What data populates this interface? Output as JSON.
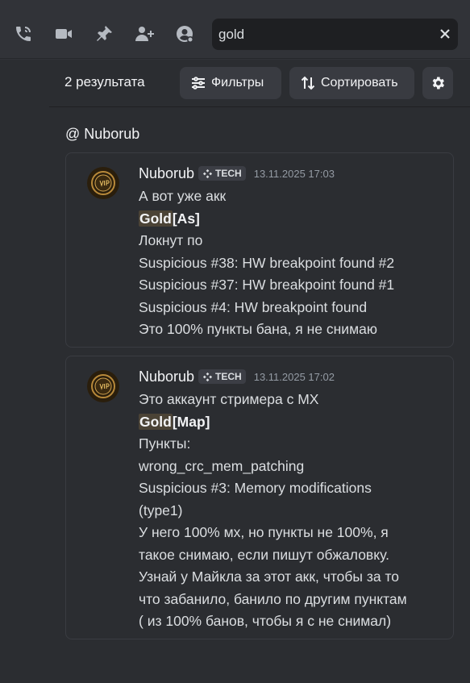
{
  "search": {
    "value": "gold"
  },
  "toolbar": {
    "icons": [
      "call-icon",
      "video-icon",
      "pin-icon",
      "add-member-icon",
      "profile-icon"
    ]
  },
  "results": {
    "count": "2 результата",
    "filters_label": "Фильтры",
    "sort_label": "Сортировать",
    "channel": "@ Nuborub"
  },
  "messages": [
    {
      "author": "Nuborub",
      "tag": "TECH",
      "time": "13.11.2025 17:03",
      "lines": [
        "А вот уже акк",
        {
          "highlight": "Gold",
          "rest": "[As]"
        },
        "Локнут по",
        "Suspicious #38: HW breakpoint found #2",
        "Suspicious #37: HW breakpoint found #1",
        "Suspicious #4: HW breakpoint found",
        "Это 100% пункты бана, я не снимаю"
      ]
    },
    {
      "author": "Nuborub",
      "tag": "TECH",
      "time": "13.11.2025 17:02",
      "lines": [
        "Это аккаунт стримера с МХ",
        {
          "highlight": "Gold",
          "rest": "[Map]"
        },
        "Пункты:",
        "wrong_crc_mem_patching",
        "Suspicious #3: Memory modifications",
        "(type1)",
        "У него 100% мх, но пункты не 100%, я",
        "такое снимаю, если пишут обжаловку.",
        "Узнай у Майкла за этот акк, чтобы за то",
        "что забанило, банило по другим пунктам",
        "( из 100% банов, чтобы я с не снимал)"
      ]
    }
  ],
  "colors": {
    "background": "#313338",
    "panel": "#2b2d31",
    "highlight": "#4b4336",
    "muted": "#949ba4"
  }
}
